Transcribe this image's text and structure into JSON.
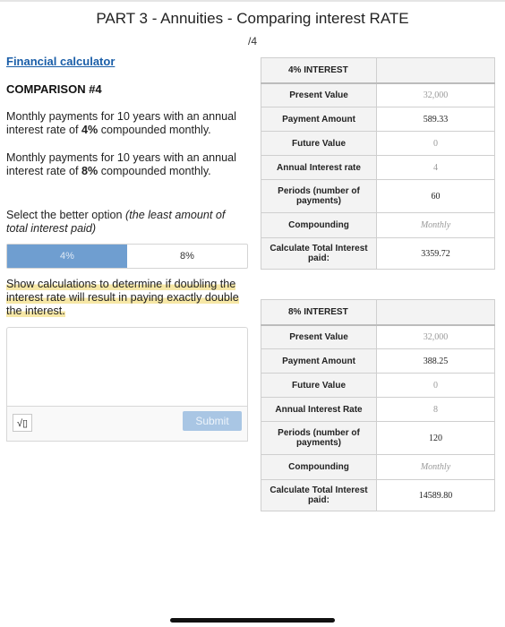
{
  "header": {
    "title": "PART 3 - Annuities - Comparing interest RATE",
    "score": "/4"
  },
  "left": {
    "link": "Financial calculator",
    "comparison": "COMPARISON #4",
    "p1_before": "Monthly payments for 10 years with an annual interest rate of ",
    "p1_bold": "4%",
    "p1_after": " compounded monthly.",
    "p2_before": "Monthly payments for 10 years with an annual interest rate of ",
    "p2_bold": "8%",
    "p2_after": " compounded monthly.",
    "p3_normal": "Select the better option ",
    "p3_italic": "(the least amount of total interest paid)",
    "options": [
      "4%",
      "8%"
    ],
    "selected_option": "4%",
    "highlight_text": "Show calculations to determine if doubling the interest rate will result in paying exactly double the interest.",
    "sqrt_symbol": "√▯",
    "submit_label": "Submit"
  },
  "table4": {
    "header": "4% INTEREST",
    "rows": [
      {
        "label": "Present Value",
        "value": "32,000"
      },
      {
        "label": "Payment Amount",
        "value": "589.33"
      },
      {
        "label": "Future Value",
        "value": "0"
      },
      {
        "label": "Annual Interest rate",
        "value": "4"
      },
      {
        "label": "Periods (number of payments)",
        "value": "60"
      },
      {
        "label": "Compounding",
        "value": "Monthly"
      },
      {
        "label": "Calculate Total Interest paid:",
        "value": "3359.72"
      }
    ]
  },
  "table8": {
    "header": "8% INTEREST",
    "rows": [
      {
        "label": "Present Value",
        "value": "32,000"
      },
      {
        "label": "Payment Amount",
        "value": "388.25"
      },
      {
        "label": "Future Value",
        "value": "0"
      },
      {
        "label": "Annual Interest Rate",
        "value": "8"
      },
      {
        "label": "Periods (number of payments)",
        "value": "120"
      },
      {
        "label": "Compounding",
        "value": "Monthly"
      },
      {
        "label": "Calculate Total Interest paid:",
        "value": "14589.80"
      }
    ]
  }
}
